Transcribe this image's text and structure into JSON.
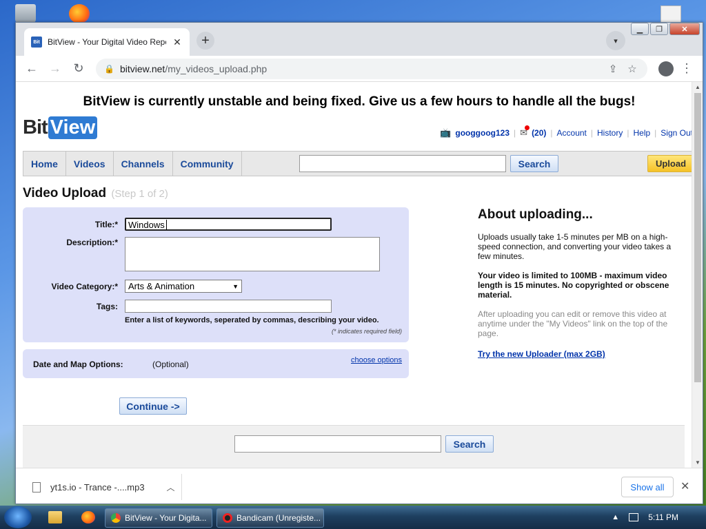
{
  "browser": {
    "tab_title": "BitView - Your Digital Video Repo",
    "tab_favicon_text": "Bit",
    "url_host": "bitview.net",
    "url_path": "/my_videos_upload.php"
  },
  "site": {
    "notice": "BitView is currently unstable and being fixed. Give us a few hours to handle all the bugs!",
    "logo_bit": "Bit",
    "logo_view": "View",
    "user": {
      "username": "googgoog123",
      "message_count": "(20)",
      "links": [
        "Account",
        "History",
        "Help",
        "Sign Out"
      ]
    },
    "nav": [
      "Home",
      "Videos",
      "Channels",
      "Community"
    ],
    "search_button": "Search",
    "upload_button": "Upload"
  },
  "page": {
    "title": "Video Upload",
    "step": "(Step 1 of 2)",
    "form": {
      "title_label": "Title:*",
      "title_value": "Windows",
      "description_label": "Description:*",
      "description_value": "",
      "category_label": "Video Category:*",
      "category_value": "Arts & Animation",
      "tags_label": "Tags:",
      "tags_value": "",
      "tags_hint": "Enter a list of keywords, seperated by commas, describing your video.",
      "required_note": "(* indicates required field)"
    },
    "date_map": {
      "label": "Date and Map Options:",
      "optional": "(Optional)",
      "link": "choose options"
    },
    "continue_button": "Continue ->",
    "about": {
      "heading": "About uploading...",
      "p1": "Uploads usually take 1-5 minutes per MB on a high-speed connection, and converting your video takes a few minutes.",
      "p2": "Your video is limited to 100MB - maximum video length is 15 minutes. No copyrighted or obscene material.",
      "p3": "After uploading you can edit or remove this video at anytime under the \"My Videos\" link on the top of the page.",
      "link": "Try the new Uploader (max 2GB)"
    },
    "footer_search_button": "Search"
  },
  "downloads": {
    "file_name": "yt1s.io - Trance -....mp3",
    "show_all": "Show all"
  },
  "taskbar": {
    "items": [
      "BitView - Your Digita...",
      "Bandicam (Unregiste..."
    ],
    "clock": "5:11 PM"
  }
}
